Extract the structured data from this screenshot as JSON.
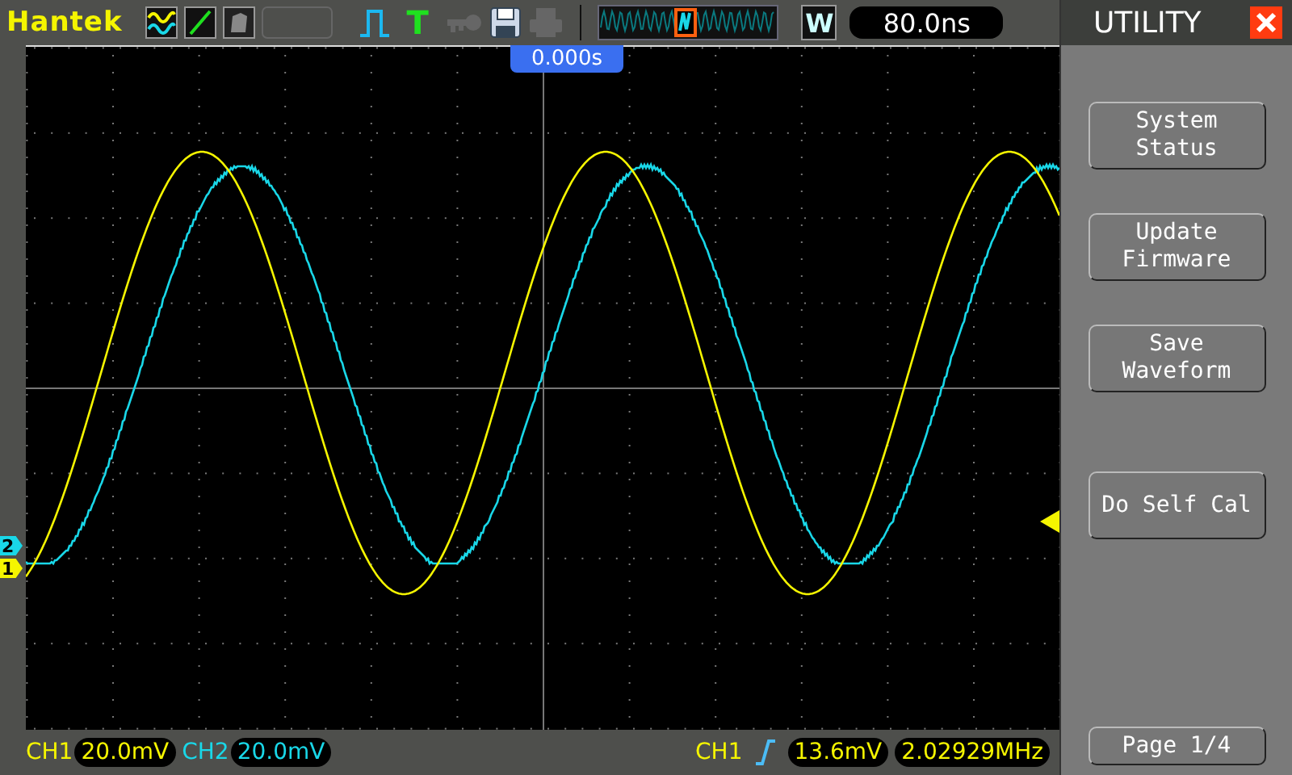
{
  "header": {
    "brand": "Hantek",
    "trigger_type": "T",
    "timebase_key": "W",
    "timebase": "80.0ns"
  },
  "screen": {
    "time_position": "0.000s",
    "channel_markers": [
      {
        "label": "2",
        "color": "#19d7e8"
      },
      {
        "label": "1",
        "color": "#f5f500"
      }
    ]
  },
  "menu": {
    "title": "UTILITY",
    "buttons": [
      {
        "lines": [
          "System",
          "Status"
        ]
      },
      {
        "lines": [
          "Update",
          "Firmware"
        ]
      },
      {
        "lines": [
          "Save",
          "Waveform"
        ]
      },
      {
        "lines": [
          "Do Self Cal"
        ]
      }
    ],
    "page": "Page 1/4"
  },
  "status_bar": {
    "channels": [
      {
        "name": "CH1",
        "scale": "20.0mV",
        "color": "#f5f500"
      },
      {
        "name": "CH2",
        "scale": "20.0mV",
        "color": "#19d7e8"
      }
    ],
    "trigger_source": "CH1",
    "trigger_level": "13.6mV",
    "frequency": "2.02929MHz"
  }
}
